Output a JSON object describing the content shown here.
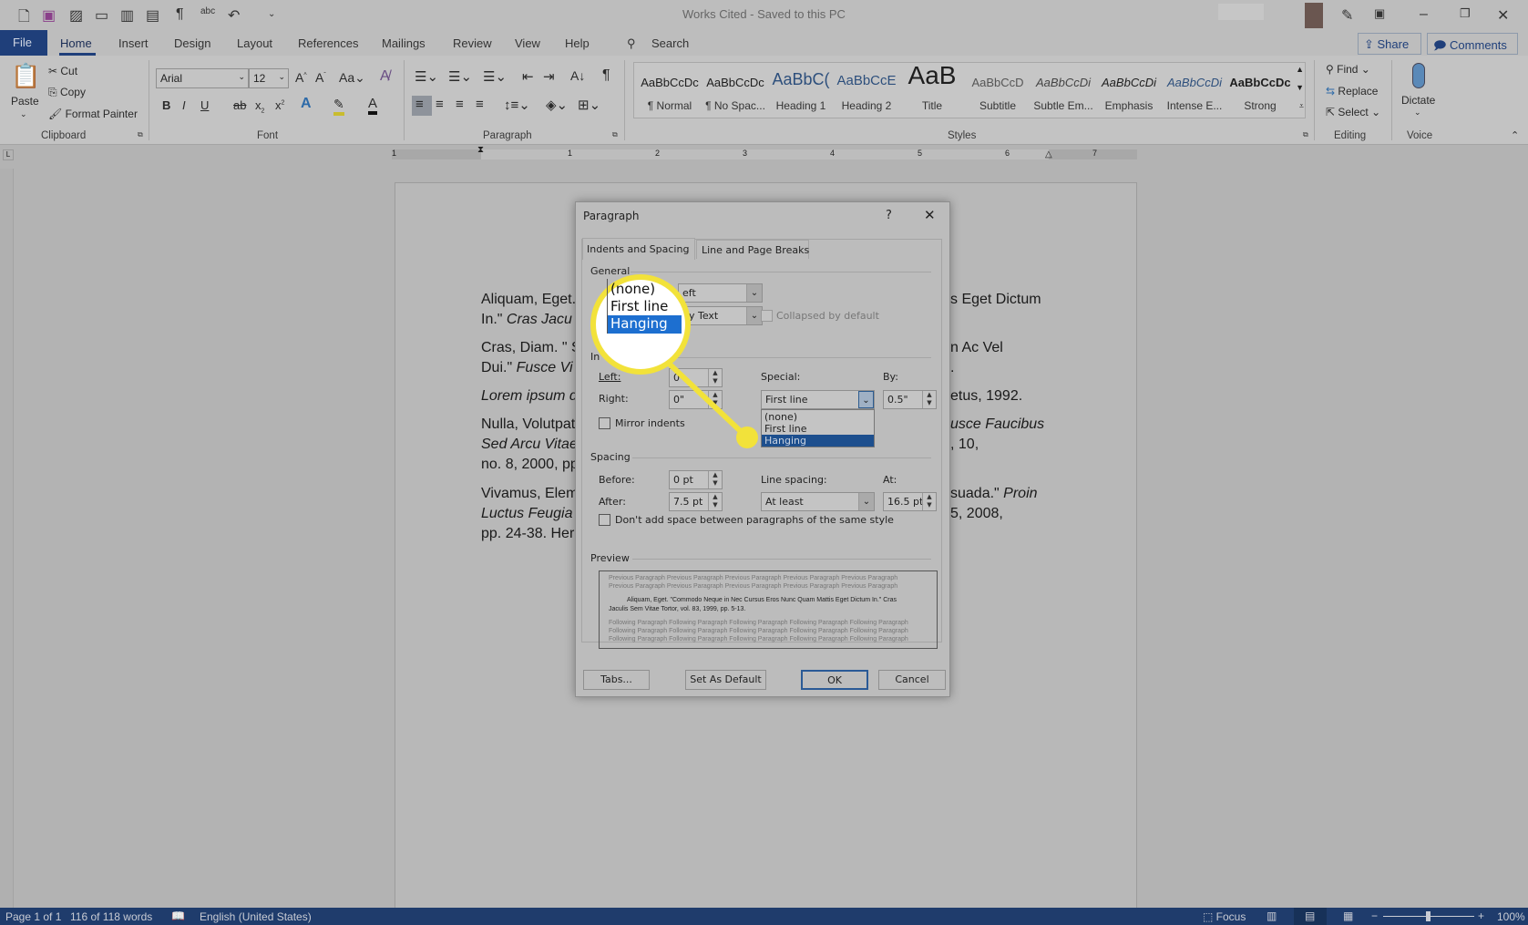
{
  "window": {
    "title": "Works Cited  -  Saved to this PC"
  },
  "qat": {
    "icons": [
      "new-document-icon",
      "save-icon",
      "touch-mode-icon",
      "print-layout-icon",
      "read-mode-icon",
      "web-layout-icon",
      "pilcrow-icon",
      "spelling-icon",
      "undo-icon"
    ]
  },
  "menu_tabs": [
    "File",
    "Home",
    "Insert",
    "Design",
    "Layout",
    "References",
    "Mailings",
    "Review",
    "View",
    "Help"
  ],
  "search": {
    "label": "Search"
  },
  "share": "Share",
  "comments": "Comments",
  "clipboard": {
    "paste": "Paste",
    "cut": "Cut",
    "copy": "Copy",
    "format_painter": "Format Painter",
    "group": "Clipboard"
  },
  "font": {
    "name": "Arial",
    "size": "12",
    "group": "Font",
    "grow": "A",
    "shrink": "A",
    "case": "Aa",
    "bold": "B",
    "italic": "I",
    "underline": "U",
    "strike": "ab",
    "sub": "x",
    "sup": "x",
    "effects": "A",
    "color": "A"
  },
  "paragraph_group": {
    "group": "Paragraph"
  },
  "styles": {
    "group": "Styles",
    "items": [
      {
        "preview": "AaBbCcDc",
        "name": "¶ Normal"
      },
      {
        "preview": "AaBbCcDc",
        "name": "¶ No Spac..."
      },
      {
        "preview": "AaBbC(",
        "name": "Heading 1"
      },
      {
        "preview": "AaBbCcE",
        "name": "Heading 2"
      },
      {
        "preview": "AaB",
        "name": "Title"
      },
      {
        "preview": "AaBbCcD",
        "name": "Subtitle"
      },
      {
        "preview": "AaBbCcDi",
        "name": "Subtle Em..."
      },
      {
        "preview": "AaBbCcDi",
        "name": "Emphasis"
      },
      {
        "preview": "AaBbCcDi",
        "name": "Intense E..."
      },
      {
        "preview": "AaBbCcDc",
        "name": "Strong"
      }
    ]
  },
  "editing": {
    "group": "Editing",
    "find": "Find",
    "replace": "Replace",
    "select": "Select"
  },
  "voice": {
    "group": "Voice",
    "dictate": "Dictate"
  },
  "ruler": {
    "labels": [
      "1",
      "1",
      "2",
      "3",
      "4",
      "5",
      "6",
      "7"
    ]
  },
  "document": {
    "left_lines": [
      {
        "parts": [
          {
            "t": "Aliquam, Eget. ",
            "i": false
          }
        ]
      },
      {
        "parts": [
          {
            "t": "In.\" ",
            "i": false
          },
          {
            "t": "Cras Jacu",
            "i": true
          }
        ]
      },
      {
        "parts": [
          {
            "t": "Cras, Diam. \" S",
            "i": false
          }
        ]
      },
      {
        "parts": [
          {
            "t": "Dui.\" ",
            "i": false
          },
          {
            "t": "Fusce Vi",
            "i": true
          }
        ]
      },
      {
        "parts": [
          {
            "t": "Lorem ipsum d",
            "i": true
          }
        ]
      },
      {
        "parts": [
          {
            "t": "Nulla, Volutpat",
            "i": false
          }
        ]
      },
      {
        "parts": [
          {
            "t": "Sed Arcu Vitae",
            "i": true
          }
        ]
      },
      {
        "parts": [
          {
            "t": "no. 8, 2000, pp",
            "i": false
          }
        ]
      },
      {
        "parts": [
          {
            "t": "Vivamus, Elem",
            "i": false
          }
        ]
      },
      {
        "parts": [
          {
            "t": "Luctus Feugia",
            "i": true
          }
        ]
      },
      {
        "parts": [
          {
            "t": "pp. 24-38. Her",
            "i": false
          }
        ]
      }
    ],
    "right_lines": [
      {
        "parts": [
          {
            "t": "s Eget Dictum",
            "i": false
          }
        ]
      },
      {
        "parts": []
      },
      {
        "parts": [
          {
            "t": "n Ac Vel",
            "i": false
          }
        ]
      },
      {
        "parts": [
          {
            "t": ".",
            "i": false
          }
        ]
      },
      {
        "parts": [
          {
            "t": "etus, 1992.",
            "i": false
          }
        ]
      },
      {
        "parts": [
          {
            "t": "usce Faucibus",
            "i": true
          }
        ]
      },
      {
        "parts": [
          {
            "t": ", 10,",
            "i": false
          }
        ]
      },
      {
        "parts": []
      },
      {
        "parts": [
          {
            "t": "suada.\" ",
            "i": false
          },
          {
            "t": "Proin",
            "i": true
          }
        ]
      },
      {
        "parts": [
          {
            "t": "5, 2008,",
            "i": false
          }
        ]
      },
      {
        "parts": []
      }
    ]
  },
  "dialog": {
    "title": "Paragraph",
    "help": "?",
    "close": "✕",
    "tabs": [
      "Indents and Spacing",
      "Line and Page Breaks"
    ],
    "general": "General",
    "alignment_value": "eft",
    "outline_value": "dy Text",
    "collapsed": "Collapsed by default",
    "indentation": "In",
    "left_label": "Left:",
    "left_value": "0\"",
    "right_label": "Right:",
    "right_value": "0\"",
    "special_label": "Special:",
    "special_value": "First line",
    "by_label": "By:",
    "by_value": "0.5\"",
    "special_options": [
      "(none)",
      "First line",
      "Hanging"
    ],
    "special_highlighted": "Hanging",
    "mirror": "Mirror indents",
    "spacing": "Spacing",
    "before_label": "Before:",
    "before_value": "0 pt",
    "after_label": "After:",
    "after_value": "7.5 pt",
    "line_spacing_label": "Line spacing:",
    "line_spacing_value": "At least",
    "at_label": "At:",
    "at_value": "16.5 pt",
    "dont_add": "Don't add space between paragraphs of the same style",
    "preview": "Preview",
    "preview_prev": [
      "Previous Paragraph Previous Paragraph Previous Paragraph Previous Paragraph Previous Paragraph",
      "Previous Paragraph Previous Paragraph Previous Paragraph Previous Paragraph Previous Paragraph"
    ],
    "preview_main": [
      "Aliquam, Eget. \"Commodo Neque in Nec Cursus Eros Nunc Quam Mattis Eget Dictum In.\" Cras",
      "Jaculis Sem Vitae Tortor, vol. 83, 1999, pp. 5-13."
    ],
    "preview_next": [
      "Following Paragraph Following Paragraph Following Paragraph Following Paragraph Following Paragraph",
      "Following Paragraph Following Paragraph Following Paragraph Following Paragraph Following Paragraph",
      "Following Paragraph Following Paragraph Following Paragraph Following Paragraph Following Paragraph"
    ],
    "tabs_btn": "Tabs...",
    "default_btn": "Set As Default",
    "ok": "OK",
    "cancel": "Cancel"
  },
  "callout": {
    "options": [
      "(none)",
      "First line",
      "Hanging"
    ],
    "color": "#f2e23a"
  },
  "status": {
    "page": "Page 1 of 1",
    "words": "116 of 118 words",
    "language": "English (United States)",
    "focus": "Focus",
    "zoom": "100%",
    "zoom_level_percent": 100
  },
  "colors": {
    "file_tab": "#1f3f7a",
    "status_bar": "#1f3c6c",
    "highlight": "#1d5fae",
    "callout": "#f2e23a"
  }
}
